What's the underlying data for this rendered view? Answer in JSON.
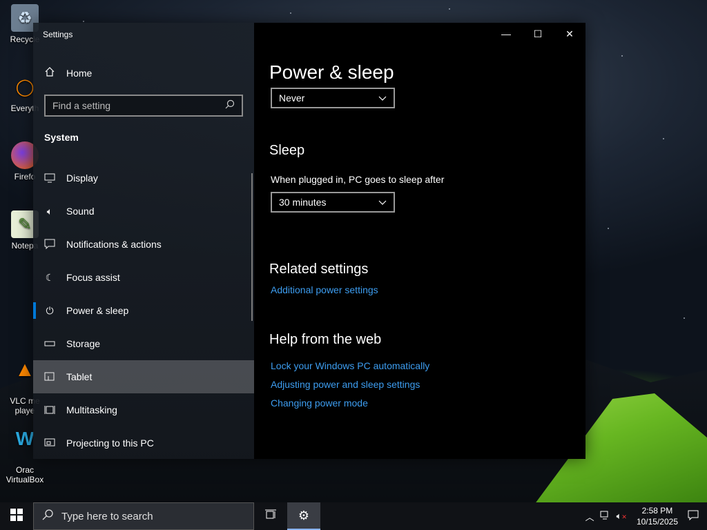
{
  "desktop": {
    "icons": [
      {
        "label": "Recycle",
        "icon": "recycle-bin-icon"
      },
      {
        "label": "Everyth",
        "icon": "everything-search-icon"
      },
      {
        "label": "Firefo",
        "icon": "firefox-icon"
      },
      {
        "label": "Notepa",
        "icon": "notepad-plus-icon"
      },
      {
        "label": "VLC me\nplaye",
        "icon": "vlc-icon"
      },
      {
        "label": "Orac\nVirtualBox",
        "icon": "virtualbox-icon"
      }
    ]
  },
  "window": {
    "title": "Settings",
    "controls": {
      "minimize": "—",
      "maximize": "☐",
      "close": "✕"
    }
  },
  "sidebar": {
    "home_label": "Home",
    "search_placeholder": "Find a setting",
    "section_label": "System",
    "items": [
      {
        "label": "Display",
        "icon": "display-icon"
      },
      {
        "label": "Sound",
        "icon": "speaker-icon"
      },
      {
        "label": "Notifications & actions",
        "icon": "notifications-icon"
      },
      {
        "label": "Focus assist",
        "icon": "moon-icon"
      },
      {
        "label": "Power & sleep",
        "icon": "power-icon",
        "selected": true
      },
      {
        "label": "Storage",
        "icon": "storage-icon"
      },
      {
        "label": "Tablet",
        "icon": "tablet-icon",
        "hover": true
      },
      {
        "label": "Multitasking",
        "icon": "multitasking-icon"
      },
      {
        "label": "Projecting to this PC",
        "icon": "projecting-icon"
      }
    ]
  },
  "main": {
    "page_title": "Power & sleep",
    "screen_dropdown_value": "Never",
    "sleep_heading": "Sleep",
    "sleep_label": "When plugged in, PC goes to sleep after",
    "sleep_dropdown_value": "30 minutes",
    "related_heading": "Related settings",
    "related_links": [
      "Additional power settings"
    ],
    "help_heading": "Help from the web",
    "help_links": [
      "Lock your Windows PC automatically",
      "Adjusting power and sleep settings",
      "Changing power mode"
    ]
  },
  "taskbar": {
    "search_placeholder": "Type here to search",
    "time": "2:58 PM",
    "date": "10/15/2025"
  },
  "colors": {
    "accent": "#0078d7",
    "link": "#3d9df0"
  }
}
